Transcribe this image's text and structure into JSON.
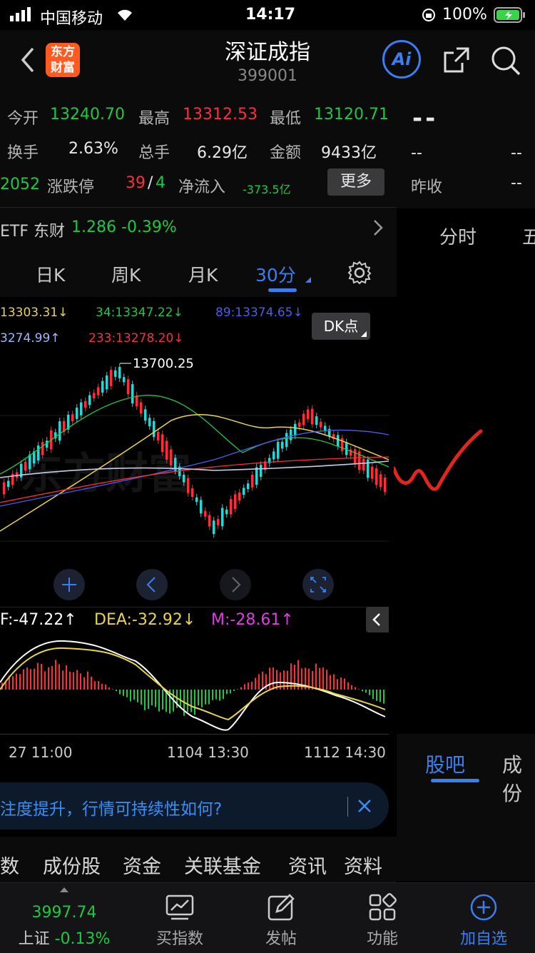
{
  "status": {
    "carrier": "中国移动",
    "time": "14:17",
    "battery": "100%"
  },
  "nav": {
    "logo_line1": "东方",
    "logo_line2": "财富",
    "title": "深证成指",
    "code": "399001",
    "ai_label": "Ai"
  },
  "quote": {
    "open_label": "今开",
    "open": "13240.70",
    "high_label": "最高",
    "high": "13312.53",
    "low_label": "最低",
    "low": "13120.71",
    "turnover_label": "换手",
    "turnover": "2.63%",
    "volume_label": "总手",
    "volume": "6.29亿",
    "amount_label": "金额",
    "amount": "9433亿",
    "updown_prefix": "2052",
    "limit_label": "涨跌停",
    "limit_up": "39",
    "limit_sep": "/",
    "limit_down": "4",
    "netflow_label": "净流入",
    "netflow": "-373.5亿",
    "more_button": "更多"
  },
  "etf": {
    "label": "ETF 东财",
    "price": "1.286",
    "change": "-0.39%"
  },
  "right_panel": {
    "price": "--",
    "left_dash": "--",
    "right_dash": "--",
    "prev_close_label": "昨收",
    "prev_close": "--",
    "tab_fenshi": "分时",
    "tab_partial": "五",
    "tab_guba": "股吧",
    "tab_chengfen": "成份"
  },
  "kline_tabs": [
    "日K",
    "周K",
    "月K",
    "30分"
  ],
  "ma_labels": {
    "ma_a": "13303.31↓",
    "ma_b": "34:13347.22↓",
    "ma_c": "89:13374.65↓",
    "ma_d": "3274.99↑",
    "ma_e": "233:13278.20↓"
  },
  "dk_button": "DK点",
  "chart_peak": "13700.25",
  "macd": {
    "dif": "F:-47.22↑",
    "dea": "DEA:-32.92↓",
    "m": "M:-28.61↑"
  },
  "time_axis": [
    "27 11:00",
    "1104 13:30",
    "1112 14:30"
  ],
  "banner_text": "注度提升，行情可持续性如何?",
  "bottom_tabs": [
    "数",
    "成份股",
    "资金",
    "关联基金",
    "资讯",
    "资料"
  ],
  "tabbar": {
    "index_value": "3997.74",
    "index_name": "上证",
    "index_change": "-0.13%",
    "buy_index": "买指数",
    "post": "发帖",
    "function": "功能",
    "add_fav": "加自选"
  },
  "colors": {
    "green": "#1dc943",
    "red": "#ff2d3a",
    "blue_active": "#3a7ff0",
    "yellow": "#e8d44d"
  }
}
